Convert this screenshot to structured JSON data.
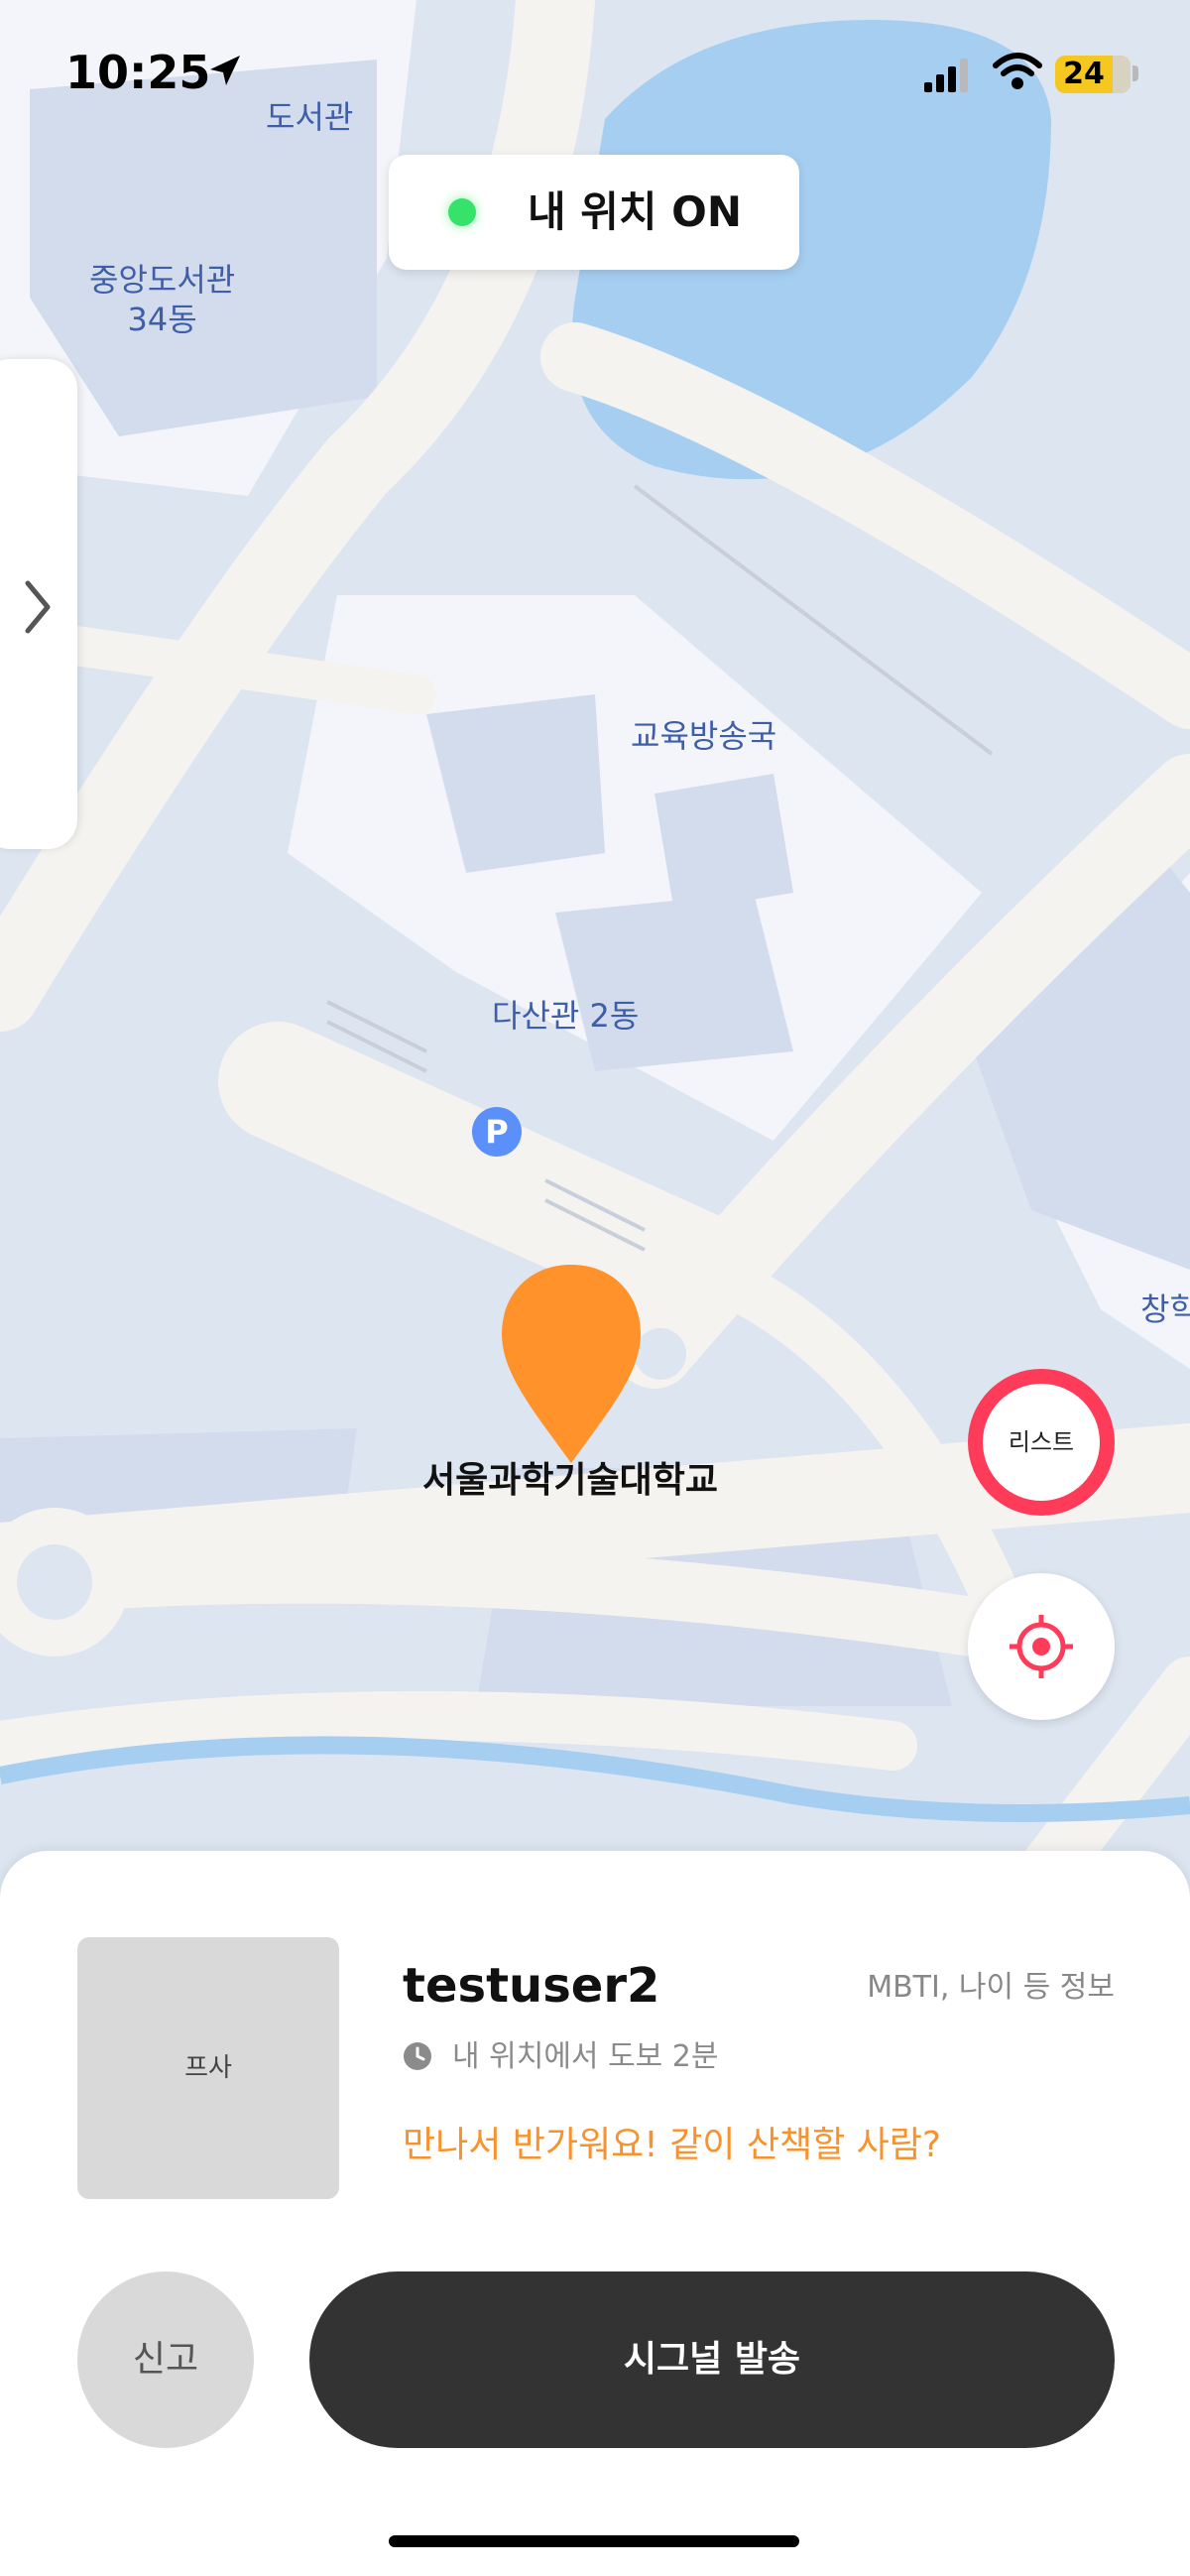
{
  "status_bar": {
    "time": "10:25",
    "battery": "24"
  },
  "location_toggle": {
    "label": "내 위치 ON",
    "status_color": "#35e36a"
  },
  "map": {
    "labels": {
      "library": "도서관",
      "central_library_line1": "중앙도서관",
      "central_library_line2": "34동",
      "broadcast": "교육방송국",
      "dasan": "다산관 2동",
      "changhak_partial": "창학",
      "parking": "P"
    },
    "pin": {
      "label": "서울과학기술대학교",
      "color": "#ff922b"
    }
  },
  "controls": {
    "list_label": "리스트",
    "accent": "#ff3b5a"
  },
  "user_card": {
    "photo_placeholder": "프사",
    "username": "testuser2",
    "info": "MBTI, 나이 등 정보",
    "distance": "내 위치에서 도보 2분",
    "message": "만나서 반가워요! 같이 산책할 사람?",
    "message_color": "#f7922d"
  },
  "actions": {
    "report_label": "신고",
    "signal_label": "시그널 발송"
  }
}
